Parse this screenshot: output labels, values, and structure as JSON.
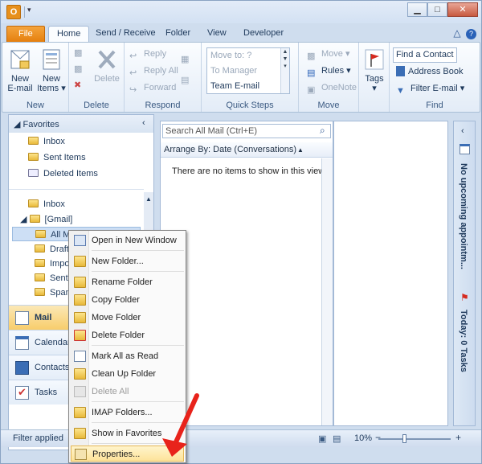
{
  "qat": {
    "logo": "O"
  },
  "window": {
    "min": "▁",
    "max": "□",
    "close": "✕"
  },
  "tabs": [
    "File",
    "Home",
    "Send / Receive",
    "Folder",
    "View",
    "Developer"
  ],
  "ribbon": {
    "new_group": {
      "new_email": "New\nE-mail",
      "new_email_l1": "New",
      "new_email_l2": "E-mail",
      "new_items_l1": "New",
      "new_items_l2": "Items ▾",
      "label": "New"
    },
    "delete_group": {
      "delete": "Delete",
      "label": "Delete"
    },
    "respond_group": {
      "reply": "Reply",
      "reply_all": "Reply All",
      "forward": "Forward",
      "label": "Respond"
    },
    "quick_steps": {
      "items": [
        "Move to: ?",
        "To Manager",
        "Team E-mail"
      ],
      "label": "Quick Steps"
    },
    "move_group": {
      "move": "Move ▾",
      "rules": "Rules ▾",
      "onenote": "OneNote",
      "label": "Move"
    },
    "tags_group": {
      "tags": "Tags",
      "tags_dd": "▾"
    },
    "find_group": {
      "find_contact": "Find a Contact ▾",
      "address_book": "Address Book",
      "filter_email": "Filter E-mail ▾",
      "label": "Find"
    }
  },
  "nav": {
    "favorites": "Favorites",
    "fav_items": [
      "Inbox",
      "Sent Items",
      "Deleted Items"
    ],
    "inbox": "Inbox",
    "gmail": "[Gmail]",
    "gmail_items": [
      "All Mail",
      "Drafts",
      "Important",
      "Sent Mail",
      "Spam"
    ],
    "buttons": [
      "Mail",
      "Calendar",
      "Contacts",
      "Tasks"
    ]
  },
  "middle": {
    "search_placeholder": "Search All Mail (Ctrl+E)",
    "arrange": "Arrange By: Date (Conversations)",
    "empty": "There are no items to show in this view."
  },
  "todo": {
    "appointments": "No upcoming appointm...",
    "tasks": "Today: 0 Tasks"
  },
  "status": {
    "text": "Filter applied",
    "zoom": "10%"
  },
  "context_menu": {
    "items": [
      "Open in New Window",
      "New Folder...",
      "Rename Folder",
      "Copy Folder",
      "Move Folder",
      "Delete Folder",
      "Mark All as Read",
      "Clean Up Folder",
      "Delete All",
      "IMAP Folders...",
      "Show in Favorites",
      "Properties..."
    ],
    "disabled": [
      "Delete All"
    ],
    "selected": "Properties..."
  },
  "colors": {
    "file_tab": "#e47d0c",
    "accent_arrow": "#e8231b",
    "selection": "#fde39a"
  }
}
